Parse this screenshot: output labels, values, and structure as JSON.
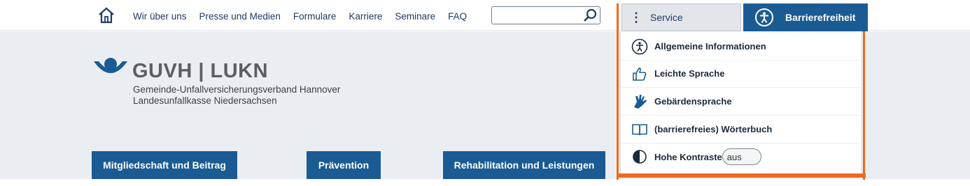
{
  "topbar": {
    "home_icon": "home-icon",
    "nav": [
      "Wir über uns",
      "Presse und Medien",
      "Formulare",
      "Karriere",
      "Seminare",
      "FAQ"
    ],
    "search": {
      "value": "",
      "placeholder": ""
    },
    "service_label": "Service",
    "barrierefreiheit_label": "Barrierefreiheit"
  },
  "logo": {
    "title": "GUVH | LUKN",
    "line1": "Gemeinde-Unfallversicherungsverband Hannover",
    "line2": "Landesunfallkasse Niedersachsen"
  },
  "tiles": [
    "Mitgliedschaft und Beitrag",
    "Prävention",
    "Rehabilitation und Leistungen"
  ],
  "dropdown": {
    "items": [
      {
        "label": "Allgemeine Informationen",
        "icon": "accessibility-icon"
      },
      {
        "label": "Leichte Sprache",
        "icon": "thumbs-up-icon"
      },
      {
        "label": "Gebärdensprache",
        "icon": "sign-language-icon"
      },
      {
        "label": "(barrierefreies) Wörterbuch",
        "icon": "book-icon"
      },
      {
        "label": "Hohe Kontraste",
        "icon": "contrast-icon",
        "toggle": "aus"
      }
    ]
  },
  "colors": {
    "brand_blue": "#1b5b94",
    "highlight": "#f06a1c",
    "hero_bg": "#eaeef3"
  }
}
